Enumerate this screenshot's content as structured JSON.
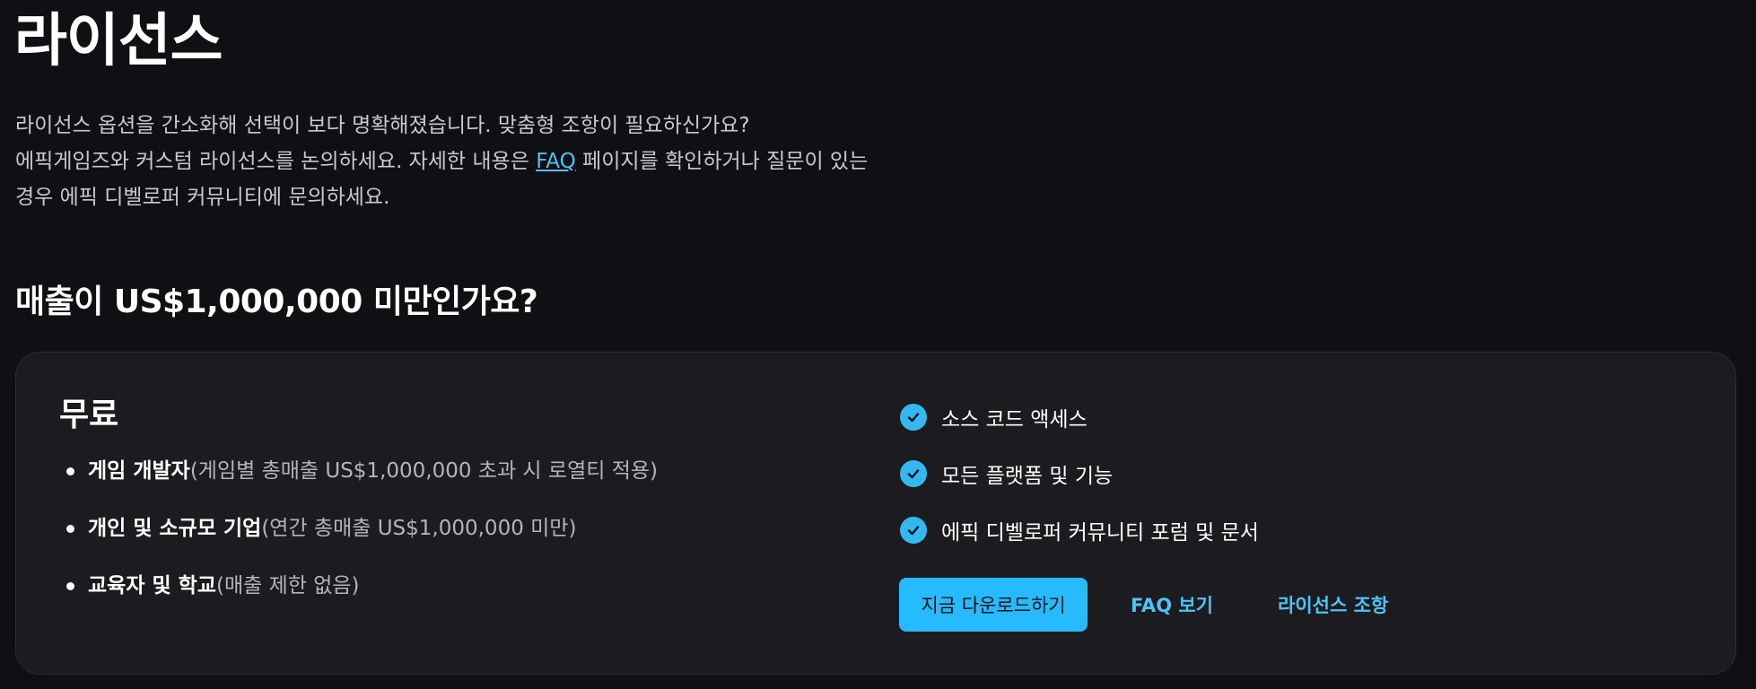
{
  "page": {
    "title": "라이선스",
    "intro": {
      "line1": "라이선스 옵션을 간소화해 선택이 보다 명확해졌습니다. 맞춤형 조항이 필요하신가요?",
      "line2_before": "에픽게임즈와 커스텀 라이선스를 논의하세요. 자세한 내용은 ",
      "faq_link": "FAQ",
      "line2_after": " 페이지를 확인하거나 질문이 있는",
      "line3": "경우 에픽 디벨로퍼 커뮤니티에 문의하세요."
    },
    "section_title": "매출이 US$1,000,000 미만인가요?"
  },
  "card": {
    "tier_name": "무료",
    "audience": [
      {
        "label": "게임 개발자",
        "note": "(게임별 총매출 US$1,000,000 초과 시 로열티 적용)"
      },
      {
        "label": "개인 및 소규모 기업",
        "note": "(연간 총매출 US$1,000,000 미만)"
      },
      {
        "label": "교육자 및 학교",
        "note": "(매출 제한 없음)"
      }
    ],
    "features": [
      "소스 코드 액세스",
      "모든 플랫폼 및 기능",
      "에픽 디벨로퍼 커뮤니티 포럼 및 문서"
    ],
    "actions": {
      "download": "지금 다운로드하기",
      "faq": "FAQ 보기",
      "terms": "라이선스 조항"
    }
  },
  "colors": {
    "background": "#101014",
    "card": "#1b1b20",
    "accent": "#26bbff",
    "link": "#4cc3f6"
  },
  "icons": {
    "feature": "check-circle-icon",
    "list": "bullet-dot-icon"
  }
}
